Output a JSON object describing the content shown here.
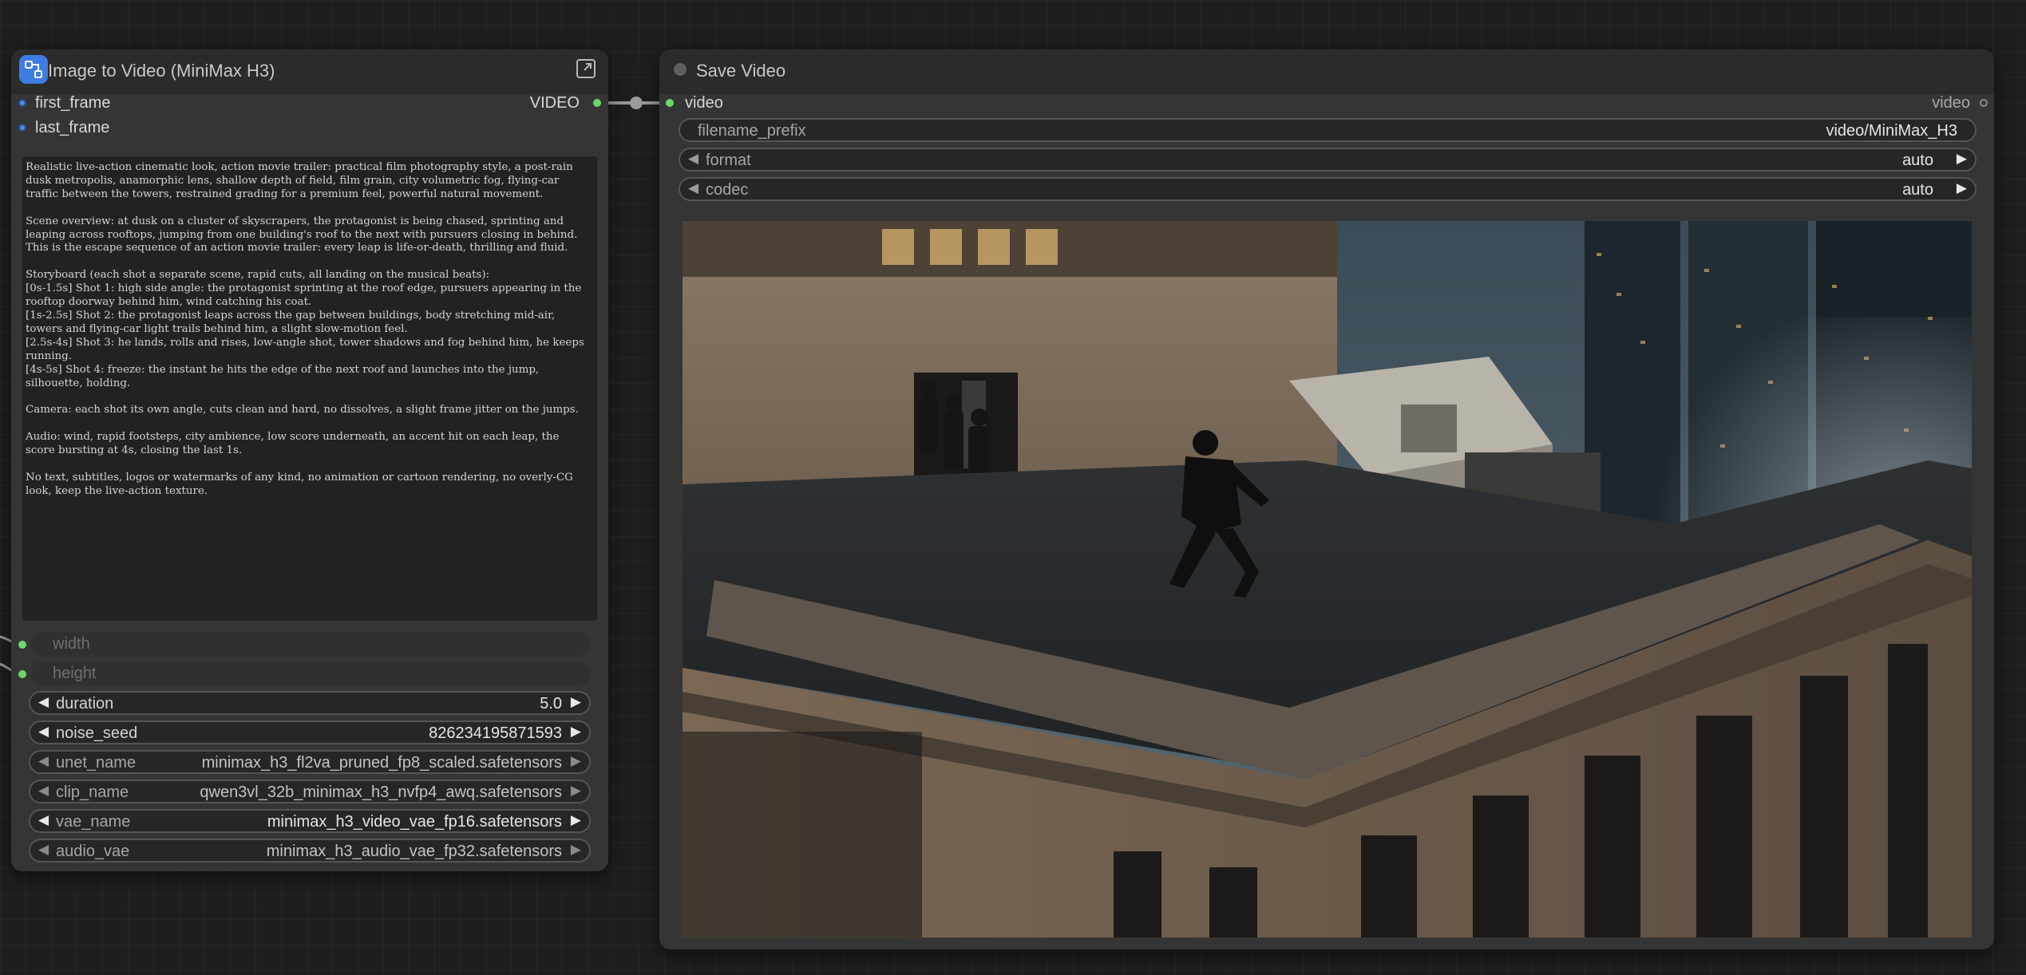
{
  "left_node": {
    "title": "Image to Video (MiniMax H3)",
    "inputs": [
      "first_frame",
      "last_frame"
    ],
    "output_label": "VIDEO",
    "prompt": "Realistic live-action cinematic look, action movie trailer: practical film photography style, a post-rain dusk metropolis, anamorphic lens, shallow depth of field, film grain, city volumetric fog, flying-car traffic between the towers, restrained grading for a premium feel, powerful natural movement.\n\nScene overview: at dusk on a cluster of skyscrapers, the protagonist is being chased, sprinting and leaping across rooftops, jumping from one building's roof to the next with pursuers closing in behind. This is the escape sequence of an action movie trailer: every leap is life-or-death, thrilling and fluid.\n\nStoryboard (each shot a separate scene, rapid cuts, all landing on the musical beats):\n[0s-1.5s] Shot 1: high side angle: the protagonist sprinting at the roof edge, pursuers appearing in the rooftop doorway behind him, wind catching his coat.\n[1s-2.5s] Shot 2: the protagonist leaps across the gap between buildings, body stretching mid-air, towers and flying-car light trails behind him, a slight slow-motion feel.\n[2.5s-4s] Shot 3: he lands, rolls and rises, low-angle shot, tower shadows and fog behind him, he keeps running.\n[4s-5s] Shot 4: freeze: the instant he hits the edge of the next roof and launches into the jump, silhouette, holding.\n\nCamera: each shot its own angle, cuts clean and hard, no dissolves, a slight frame jitter on the jumps.\n\nAudio: wind, rapid footsteps, city ambience, low score underneath, an accent hit on each leap, the score bursting at 4s, closing the last 1s.\n\nNo text, subtitles, logos or watermarks of any kind, no animation or cartoon rendering, no overly-CG look, keep the live-action texture.",
    "converted_widgets": [
      "width",
      "height"
    ],
    "widgets": [
      {
        "label": "duration",
        "value": "5.0"
      },
      {
        "label": "noise_seed",
        "value": "826234195871593"
      },
      {
        "label": "unet_name",
        "value": "minimax_h3_fl2va_pruned_fp8_scaled.safetensors"
      },
      {
        "label": "clip_name",
        "value": "qwen3vl_32b_minimax_h3_nvfp4_awq.safetensors"
      },
      {
        "label": "vae_name",
        "value": "minimax_h3_video_vae_fp16.safetensors"
      },
      {
        "label": "audio_vae",
        "value": "minimax_h3_audio_vae_fp32.safetensors"
      }
    ]
  },
  "right_node": {
    "title": "Save Video",
    "input_label": "video",
    "output_label": "video",
    "widgets": [
      {
        "label": "filename_prefix",
        "value": "video/MiniMax_H3"
      },
      {
        "label": "format",
        "value": "auto"
      },
      {
        "label": "codec",
        "value": "auto"
      }
    ]
  },
  "colors": {
    "canvas": "#1e1e1e",
    "node_body": "#353535",
    "node_header": "#2b2b2b",
    "slot_green": "#6bd86b",
    "slot_blue": "#4d8fe6",
    "badge_blue": "#3d7ce0"
  },
  "icons": [
    "node-badge-icon",
    "expand-icon",
    "arrow-left-icon",
    "arrow-right-icon"
  ]
}
